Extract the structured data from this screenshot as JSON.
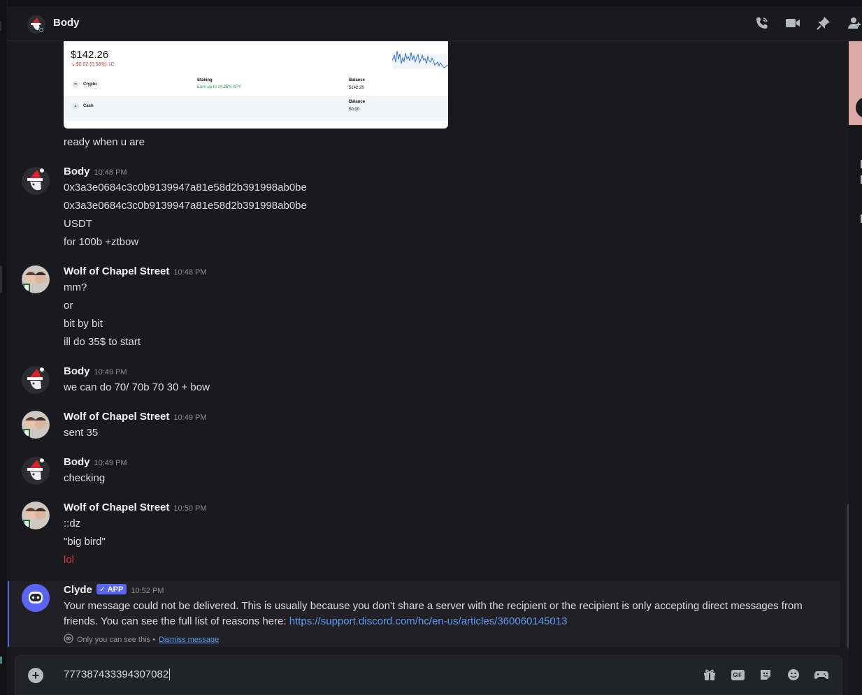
{
  "header": {
    "title": "Body"
  },
  "embed": {
    "price": "$142.26",
    "change": "↘ $0.02 (0.58%)",
    "period": "1D",
    "rows": [
      {
        "label": "Crypto",
        "mid_title": "Staking",
        "mid_sub": "Earn up to 14.25% APY",
        "right_title": "Balance",
        "right_value": "$142.26"
      },
      {
        "label": "Cash",
        "mid_title": "",
        "mid_sub": "",
        "right_title": "Balance",
        "right_value": "$0.00"
      }
    ]
  },
  "messages": {
    "pre_line": "ready when u are",
    "m1": {
      "author": "Body",
      "time": "10:48 PM",
      "lines": [
        "0x3a3e0684c3c0b9139947a81e58d2b391998ab0be",
        "0x3a3e0684c3c0b9139947a81e58d2b391998ab0be",
        "USDT",
        "for 100b +ztbow"
      ]
    },
    "m2": {
      "author": "Wolf of Chapel Street",
      "time": "10:48 PM",
      "lines": [
        "mm?",
        "or",
        "bit by bit",
        "ill do 35$ to start"
      ]
    },
    "m3": {
      "author": "Body",
      "time": "10:49 PM",
      "lines": [
        "we can do 70/ 70b 70 30 + bow"
      ]
    },
    "m4": {
      "author": "Wolf of Chapel Street",
      "time": "10:49 PM",
      "lines": [
        "sent 35"
      ]
    },
    "m5": {
      "author": "Body",
      "time": "10:49 PM",
      "lines": [
        "checking"
      ]
    },
    "m6": {
      "author": "Wolf of Chapel Street",
      "time": "10:50 PM",
      "lines": [
        "::dz",
        "\"big bird\"",
        "lol"
      ]
    }
  },
  "clyde": {
    "author": "Clyde",
    "badge": "APP",
    "time": "10:52 PM",
    "text": "Your message could not be delivered. This is usually because you don't share a server with the recipient or the recipient is only accepting direct messages from friends. You can see the full list of reasons here: ",
    "link": "https://support.discord.com/hc/en-us/articles/360060145013",
    "note": "Only you can see this •",
    "dismiss": "Dismiss message"
  },
  "composer": {
    "value": "777387433394307082"
  },
  "colors": {
    "accent": "#5865f2",
    "link": "#5b9cf4",
    "error_text": "#da373c"
  },
  "icons": {
    "header": [
      "phone-call-icon",
      "video-call-icon",
      "pin-icon",
      "add-friend-icon"
    ],
    "composer": [
      "gift-icon",
      "gif-icon",
      "sticker-icon",
      "emoji-icon",
      "activity-icon"
    ]
  }
}
